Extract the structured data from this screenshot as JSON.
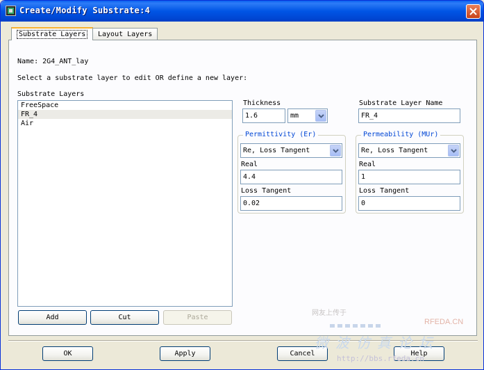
{
  "window": {
    "title": "Create/Modify Substrate:4",
    "icon": "app-icon"
  },
  "tabs": [
    {
      "label": "Substrate Layers",
      "active": true
    },
    {
      "label": "Layout Layers",
      "active": false
    }
  ],
  "name_line": "Name: 2G4_ANT_lay",
  "instruction": "Select a substrate layer to edit OR define a new layer:",
  "layers": {
    "label": "Substrate Layers",
    "items": [
      "FreeSpace",
      "FR_4",
      "Air"
    ],
    "selected_index": 1
  },
  "list_buttons": {
    "add": "Add",
    "cut": "Cut",
    "paste": "Paste"
  },
  "thickness": {
    "label": "Thickness",
    "value": "1.6",
    "unit": "mm"
  },
  "layer_name": {
    "label": "Substrate Layer Name",
    "value": "FR_4"
  },
  "permittivity": {
    "title": "Permittivity (Er)",
    "model": "Re, Loss Tangent",
    "real_label": "Real",
    "real_value": "4.4",
    "loss_label": "Loss Tangent",
    "loss_value": "0.02"
  },
  "permeability": {
    "title": "Permeability (MUr)",
    "model": "Re, Loss Tangent",
    "real_label": "Real",
    "real_value": "1",
    "loss_label": "Loss Tangent",
    "loss_value": "0"
  },
  "footer": {
    "ok": "OK",
    "apply": "Apply",
    "cancel": "Cancel",
    "help": "Help"
  },
  "watermark": {
    "line1": "网友上传于",
    "brand": "RFEDA.CN",
    "big": "微波仿真论坛",
    "url": "http://bbs.rfeda.cn"
  },
  "colors": {
    "title_bar": "#0055e5",
    "group_title": "#0046d5",
    "tab_highlight": "#f7b12e",
    "close_button": "#c7421a"
  }
}
